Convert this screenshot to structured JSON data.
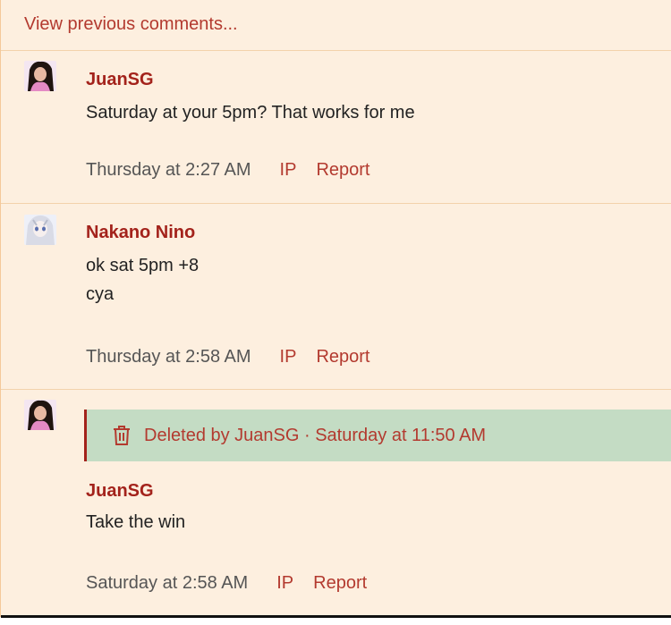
{
  "thread": {
    "view_previous_label": "View previous comments..."
  },
  "comments": [
    {
      "author": "JuanSG",
      "lines": [
        "Saturday at your 5pm? That works for me"
      ],
      "date": "Thursday at 2:27 AM",
      "ip_label": "IP",
      "report_label": "Report"
    },
    {
      "author": "Nakano Nino",
      "lines": [
        "ok sat 5pm +8",
        "cya"
      ],
      "date": "Thursday at 2:58 AM",
      "ip_label": "IP",
      "report_label": "Report"
    },
    {
      "deleted_notice": "Deleted by JuanSG · Saturday at 11:50 AM",
      "author": "JuanSG",
      "lines": [
        "Take the win"
      ],
      "date": "Saturday at 2:58 AM",
      "ip_label": "IP",
      "report_label": "Report"
    }
  ],
  "icons": {
    "trash": "trash-icon"
  },
  "colors": {
    "background": "#fdefdf",
    "link": "#b33a2f",
    "author": "#a3221b",
    "deleted_bar": "#c4dcc4"
  }
}
